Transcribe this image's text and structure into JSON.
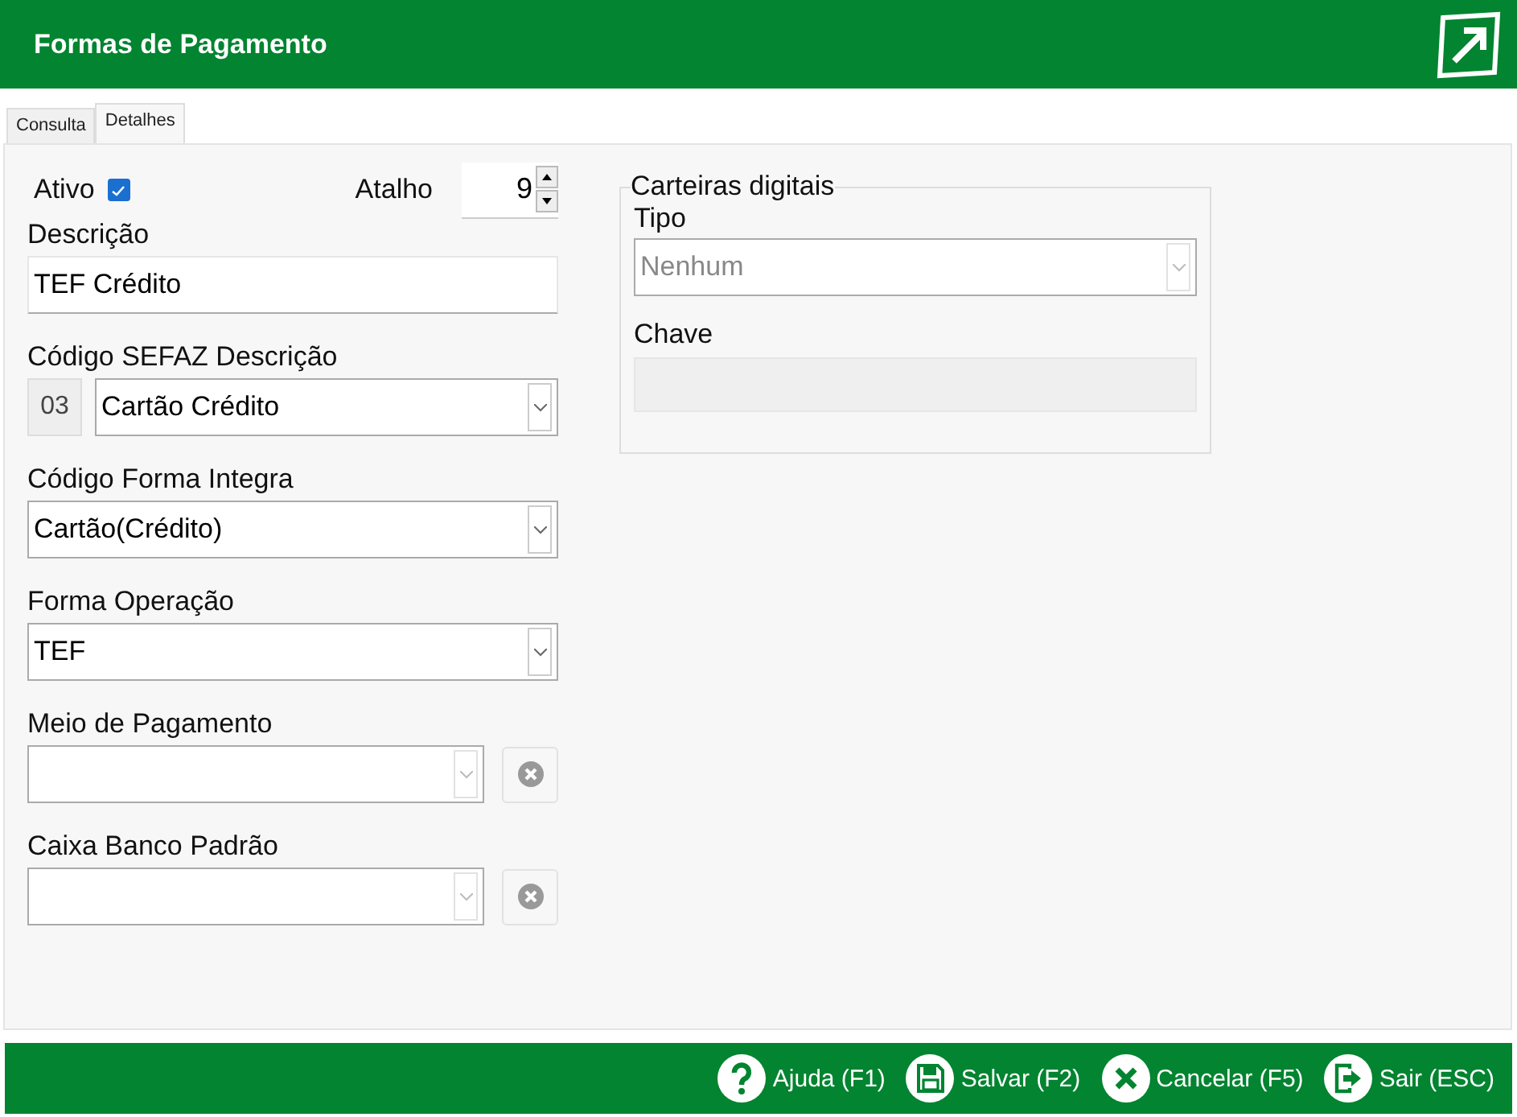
{
  "window": {
    "title": "Formas de Pagamento"
  },
  "tabs": [
    {
      "label": "Consulta",
      "selected": false
    },
    {
      "label": "Detalhes",
      "selected": true
    }
  ],
  "ativo": {
    "label": "Ativo",
    "checked": true
  },
  "atalho": {
    "label": "Atalho",
    "value": "9"
  },
  "fields": [
    {
      "kind": "text",
      "label": "Descrição",
      "value": "TEF Crédito"
    },
    {
      "kind": "code-select",
      "label": "Código SEFAZ Descrição",
      "code": "03",
      "value": "Cartão Crédito"
    },
    {
      "kind": "select",
      "label": "Código Forma Integra",
      "value": "Cartão(Crédito)"
    },
    {
      "kind": "select",
      "label": "Forma Operação",
      "value": "TEF"
    },
    {
      "kind": "clear-select",
      "label": "Meio de Pagamento"
    },
    {
      "kind": "clear-select",
      "label": "Caixa Banco Padrão"
    }
  ],
  "wallets": {
    "legend": "Carteiras digitais",
    "type_label": "Tipo",
    "type_value": "Nenhum",
    "key_label": "Chave"
  },
  "buttons": [
    {
      "kind": "help",
      "label": "Ajuda (F1)"
    },
    {
      "kind": "save",
      "label": "Salvar (F2)"
    },
    {
      "kind": "cancel",
      "label": "Cancelar (F5)"
    },
    {
      "kind": "exit",
      "label": "Sair (ESC)"
    }
  ]
}
